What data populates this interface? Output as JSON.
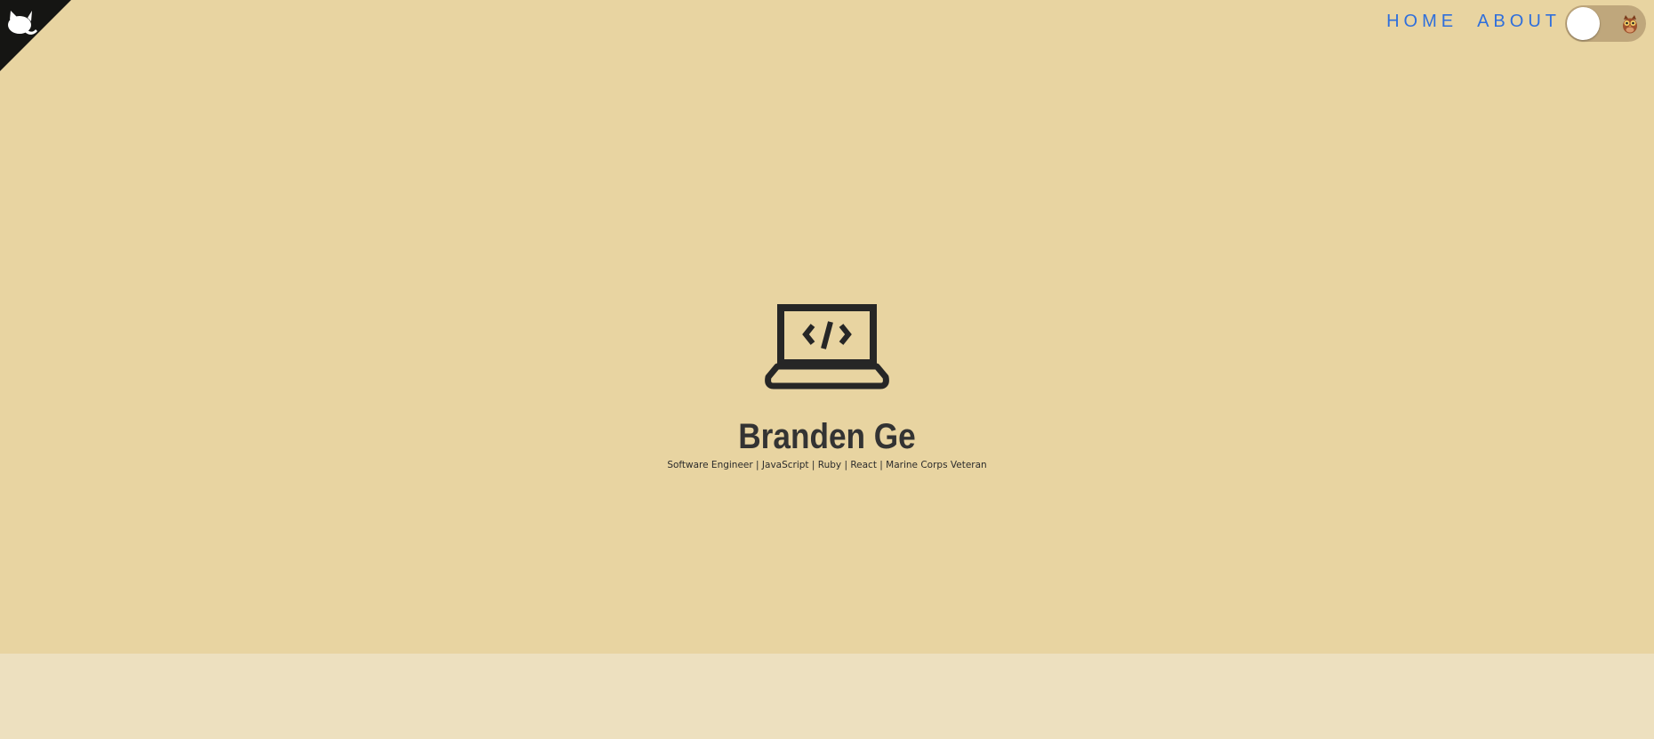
{
  "nav": {
    "home_label": "HOME",
    "about_label": "ABOUT",
    "link_color": "#2f6fdc"
  },
  "theme_toggle": {
    "icon": "owl-icon",
    "state": "off"
  },
  "corner": {
    "icon": "github-octocat-icon"
  },
  "hero": {
    "icon": "laptop-code-icon",
    "name": "Branden Ge",
    "subtitle": "Software Engineer | JavaScript | Ruby | React | Marine Corps Veteran",
    "background": "#e8d4a1"
  },
  "lower_section": {
    "background": "#ede0bf"
  }
}
